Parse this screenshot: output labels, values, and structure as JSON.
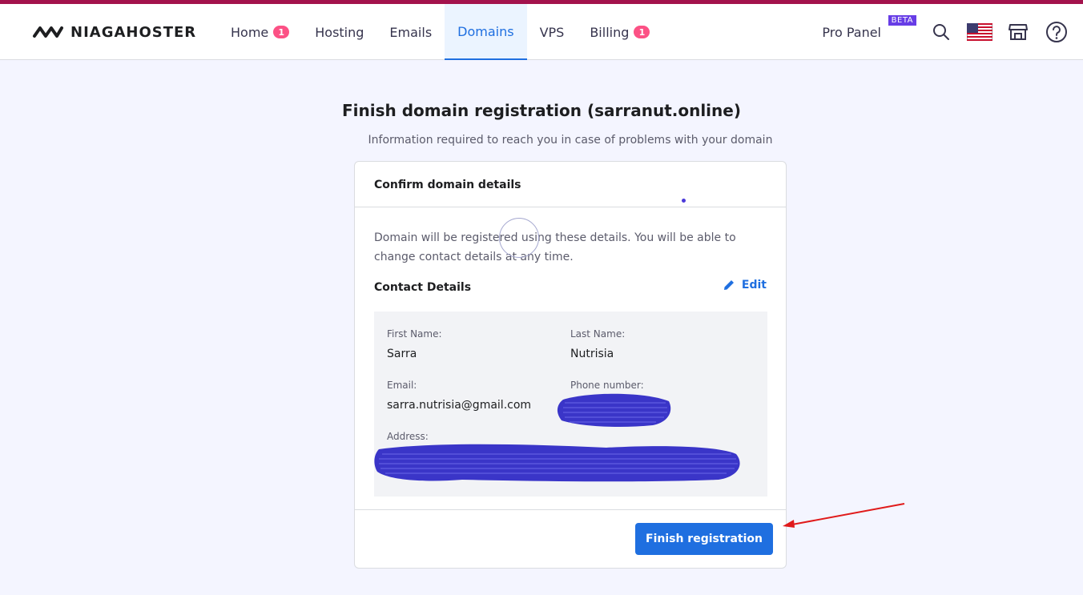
{
  "brand": {
    "name": "NIAGAHOSTER"
  },
  "nav": {
    "tabs": [
      {
        "label": "Home",
        "badge": "1"
      },
      {
        "label": "Hosting"
      },
      {
        "label": "Emails"
      },
      {
        "label": "Domains",
        "active": true
      },
      {
        "label": "VPS"
      },
      {
        "label": "Billing",
        "badge": "1"
      }
    ],
    "pro_panel": "Pro Panel",
    "beta": "BETA",
    "icons": [
      "search-icon",
      "us-flag-icon",
      "store-icon",
      "help-icon"
    ]
  },
  "page": {
    "title": "Finish domain registration (sarranut.online)",
    "subtitle": "Information required to reach you in case of problems with your domain"
  },
  "card": {
    "header": "Confirm domain details",
    "description": "Domain will be registered using these details. You will be able to change contact details at any time.",
    "contact_title": "Contact Details",
    "edit_label": "Edit",
    "fields": {
      "first_name_label": "First Name:",
      "first_name": "Sarra",
      "last_name_label": "Last Name:",
      "last_name": "Nutrisia",
      "email_label": "Email:",
      "email": "sarra.nutrisia@gmail.com",
      "phone_label": "Phone number:",
      "address_label": "Address:"
    },
    "finish_button": "Finish registration"
  },
  "colors": {
    "accent": "#1f6fe0",
    "top_bar": "#a3124c",
    "badge": "#fc5185",
    "beta": "#673de6",
    "redaction": "#3a35c8",
    "annotation_arrow": "#e01b1b"
  }
}
